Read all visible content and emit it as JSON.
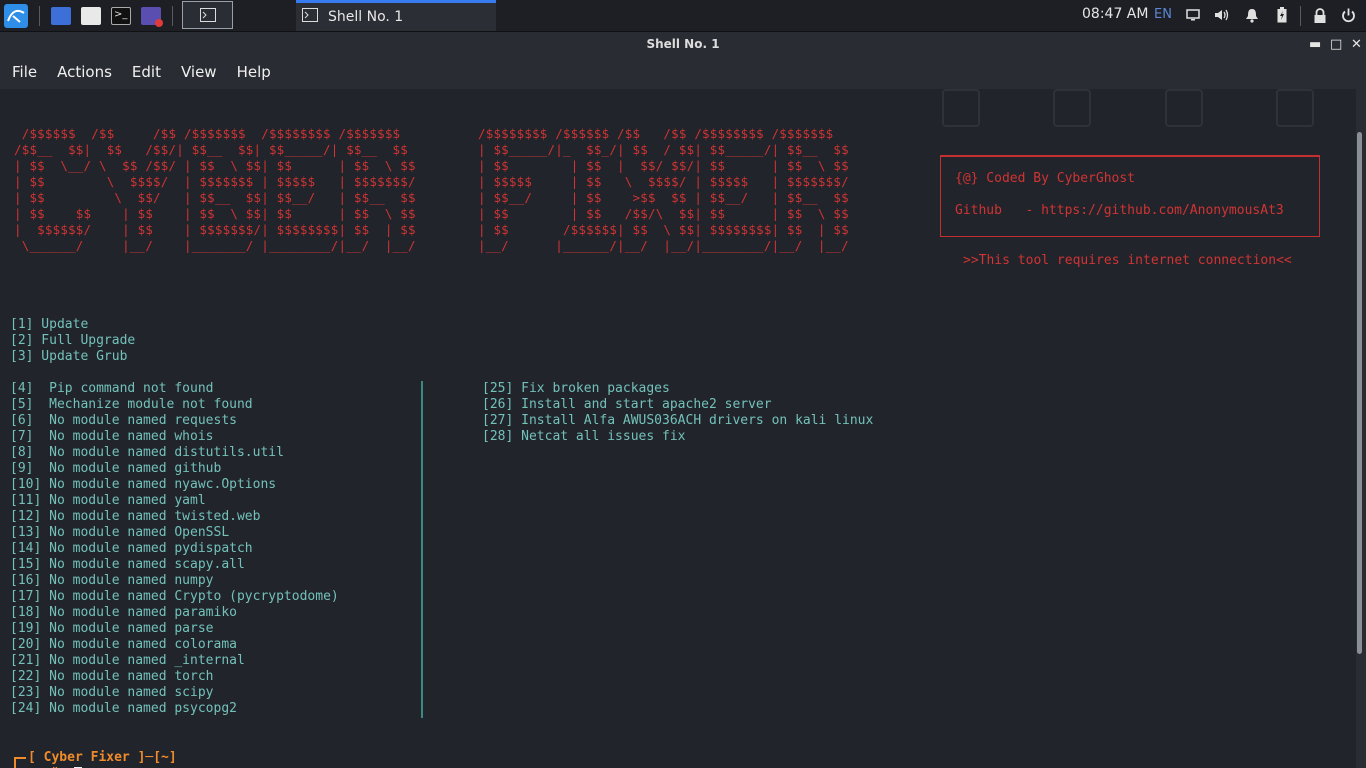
{
  "panel": {
    "task_title": "Shell No. 1",
    "clock": "08:47 AM",
    "lang": "EN",
    "icons": [
      "kali-menu-icon",
      "workspace-icon",
      "file-manager-icon",
      "terminal-icon",
      "screen-recorder-icon",
      "terminal-task-icon"
    ],
    "tray_icons": [
      "display-icon",
      "volume-icon",
      "notification-icon",
      "battery-icon",
      "lock-icon",
      "power-icon"
    ]
  },
  "window": {
    "title": "Shell No. 1",
    "menu": [
      "File",
      "Actions",
      "Edit",
      "View",
      "Help"
    ],
    "controls": {
      "minimize": "▬",
      "maximize": "□",
      "close": "✕"
    }
  },
  "terminal": {
    "banner_left": " /$$$$$$  /$$     /$$ /$$$$$$$  /$$$$$$$$ /$$$$$$$ \n/$$__  $$|  $$   /$$/| $$__  $$| $$_____/| $$__  $$\n| $$  \\__/ \\  $$ /$$/ | $$  \\ $$| $$      | $$  \\ $$\n| $$        \\  $$$$/  | $$$$$$$ | $$$$$   | $$$$$$$/\n| $$         \\  $$/   | $$__  $$| $$__/   | $$__  $$\n| $$    $$    | $$    | $$  \\ $$| $$      | $$  \\ $$\n|  $$$$$$/    | $$    | $$$$$$$/| $$$$$$$$| $$  | $$\n \\______/     |__/    |_______/ |________/|__/  |__/",
    "banner_right": "/$$$$$$$$ /$$$$$$ /$$   /$$ /$$$$$$$$ /$$$$$$$ \n| $$_____/|_  $$_/| $$  / $$| $$_____/| $$__  $$\n| $$        | $$  |  $$/ $$/| $$      | $$  \\ $$\n| $$$$$     | $$   \\  $$$$/ | $$$$$   | $$$$$$$/\n| $$__/     | $$    >$$  $$ | $$__/   | $$__  $$\n| $$        | $$   /$$/\\  $$| $$      | $$  \\ $$\n| $$       /$$$$$$| $$  \\ $$| $$$$$$$$| $$  | $$\n|__/      |______/|__/  |__/|________/|__/  |__/",
    "info_coded": "{@} Coded By CyberGhost",
    "info_github": "Github   - https://github.com/AnonymousAt3",
    "info_note": ">>This tool requires internet connection<<",
    "menu_top": [
      "[1] Update",
      "[2] Full Upgrade",
      "[3] Update Grub"
    ],
    "menu_left": [
      "[4]  Pip command not found",
      "[5]  Mechanize module not found",
      "[6]  No module named requests",
      "[7]  No module named whois",
      "[8]  No module named distutils.util",
      "[9]  No module named github",
      "[10] No module named nyawc.Options",
      "[11] No module named yaml",
      "[12] No module named twisted.web",
      "[13] No module named OpenSSL",
      "[14] No module named pydispatch",
      "[15] No module named scapy.all",
      "[16] No module named numpy",
      "[17] No module named Crypto (pycryptodome)",
      "[18] No module named paramiko",
      "[19] No module named parse",
      "[20] No module named colorama",
      "[21] No module named _internal",
      "[22] No module named torch",
      "[23] No module named scipy",
      "[24] No module named psycopg2"
    ],
    "menu_right": [
      "[25] Fix broken packages",
      "[26] Install and start apache2 server",
      "[27] Install Alfa AWUS036ACH drivers on kali linux",
      "[28] Netcat all issues fix"
    ],
    "prompt_line1": "[ Cyber Fixer ]─[~]",
    "prompt_line2": "#"
  }
}
